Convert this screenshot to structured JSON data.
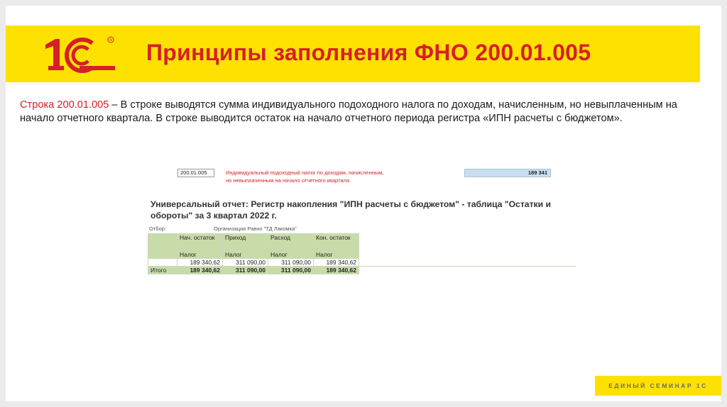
{
  "header": {
    "logo_text": "1С",
    "title": "Принципы заполнения ФНО 200.01.005"
  },
  "body": {
    "lead": "Строка 200.01.005",
    "text": " – В строке выводятся сумма индивидуального подоходного налога по доходам, начисленным, но невыплаченным на начало отчетного квартала. В строке выводится остаток на начало отчетного периода регистра «ИПН расчеты с бюджетом»."
  },
  "form_line": {
    "code": "200.01.005",
    "desc_line1": "Индивидуальный подоходный налог по доходам, начисленным,",
    "desc_line2": "но невыплаченным на начало отчетного квартала",
    "value": "189 341"
  },
  "report": {
    "title_line1": "Универсальный отчет: Регистр накопления \"ИПН расчеты с бюджетом\" - таблица \"Остатки и",
    "title_line2": "обороты\" за 3 квартал 2022 г.",
    "filter_label": "Отбор:",
    "filter_value": "Организация Равно \"ТД Лакомка\"",
    "headers": [
      "Нач. остаток",
      "Приход",
      "Расход",
      "Кон. остаток"
    ],
    "subheaders": [
      "Налог",
      "Налог",
      "Налог",
      "Налог"
    ],
    "row": [
      "189 340,62",
      "311 090,00",
      "311 090,00",
      "189 340,62"
    ],
    "total_label": "Итого",
    "total": [
      "189 340,62",
      "311 090,00",
      "311 090,00",
      "189 340,62"
    ]
  },
  "footer": {
    "badge": "ЕДИНЫЙ СЕМИНАР 1С"
  },
  "colors": {
    "accent_red": "#d61f26",
    "brand_yellow": "#ffe100",
    "table_green": "#c8dcaa"
  }
}
